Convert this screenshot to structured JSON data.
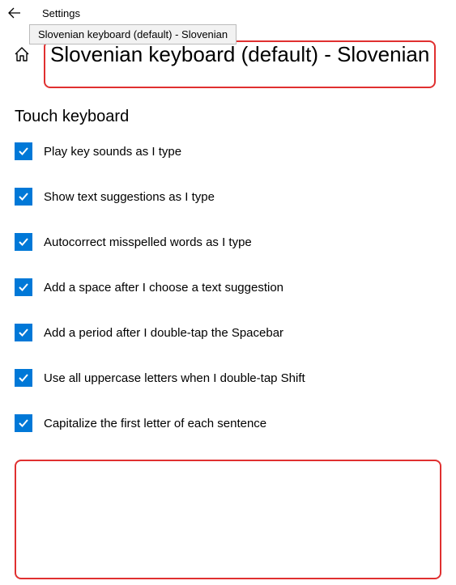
{
  "header": {
    "settings_label": "Settings",
    "tooltip": "Slovenian keyboard (default) - Slovenian"
  },
  "title": "Slovenian keyboard (default) - Slovenian",
  "section_header": "Touch keyboard",
  "options": [
    {
      "label": "Play key sounds as I type"
    },
    {
      "label": "Show text suggestions as I type"
    },
    {
      "label": "Autocorrect misspelled words as I type"
    },
    {
      "label": "Add a space after I choose a text suggestion"
    },
    {
      "label": "Add a period after I double-tap the Spacebar"
    },
    {
      "label": "Use all uppercase letters when I double-tap Shift"
    },
    {
      "label": "Capitalize the first letter of each sentence"
    }
  ]
}
